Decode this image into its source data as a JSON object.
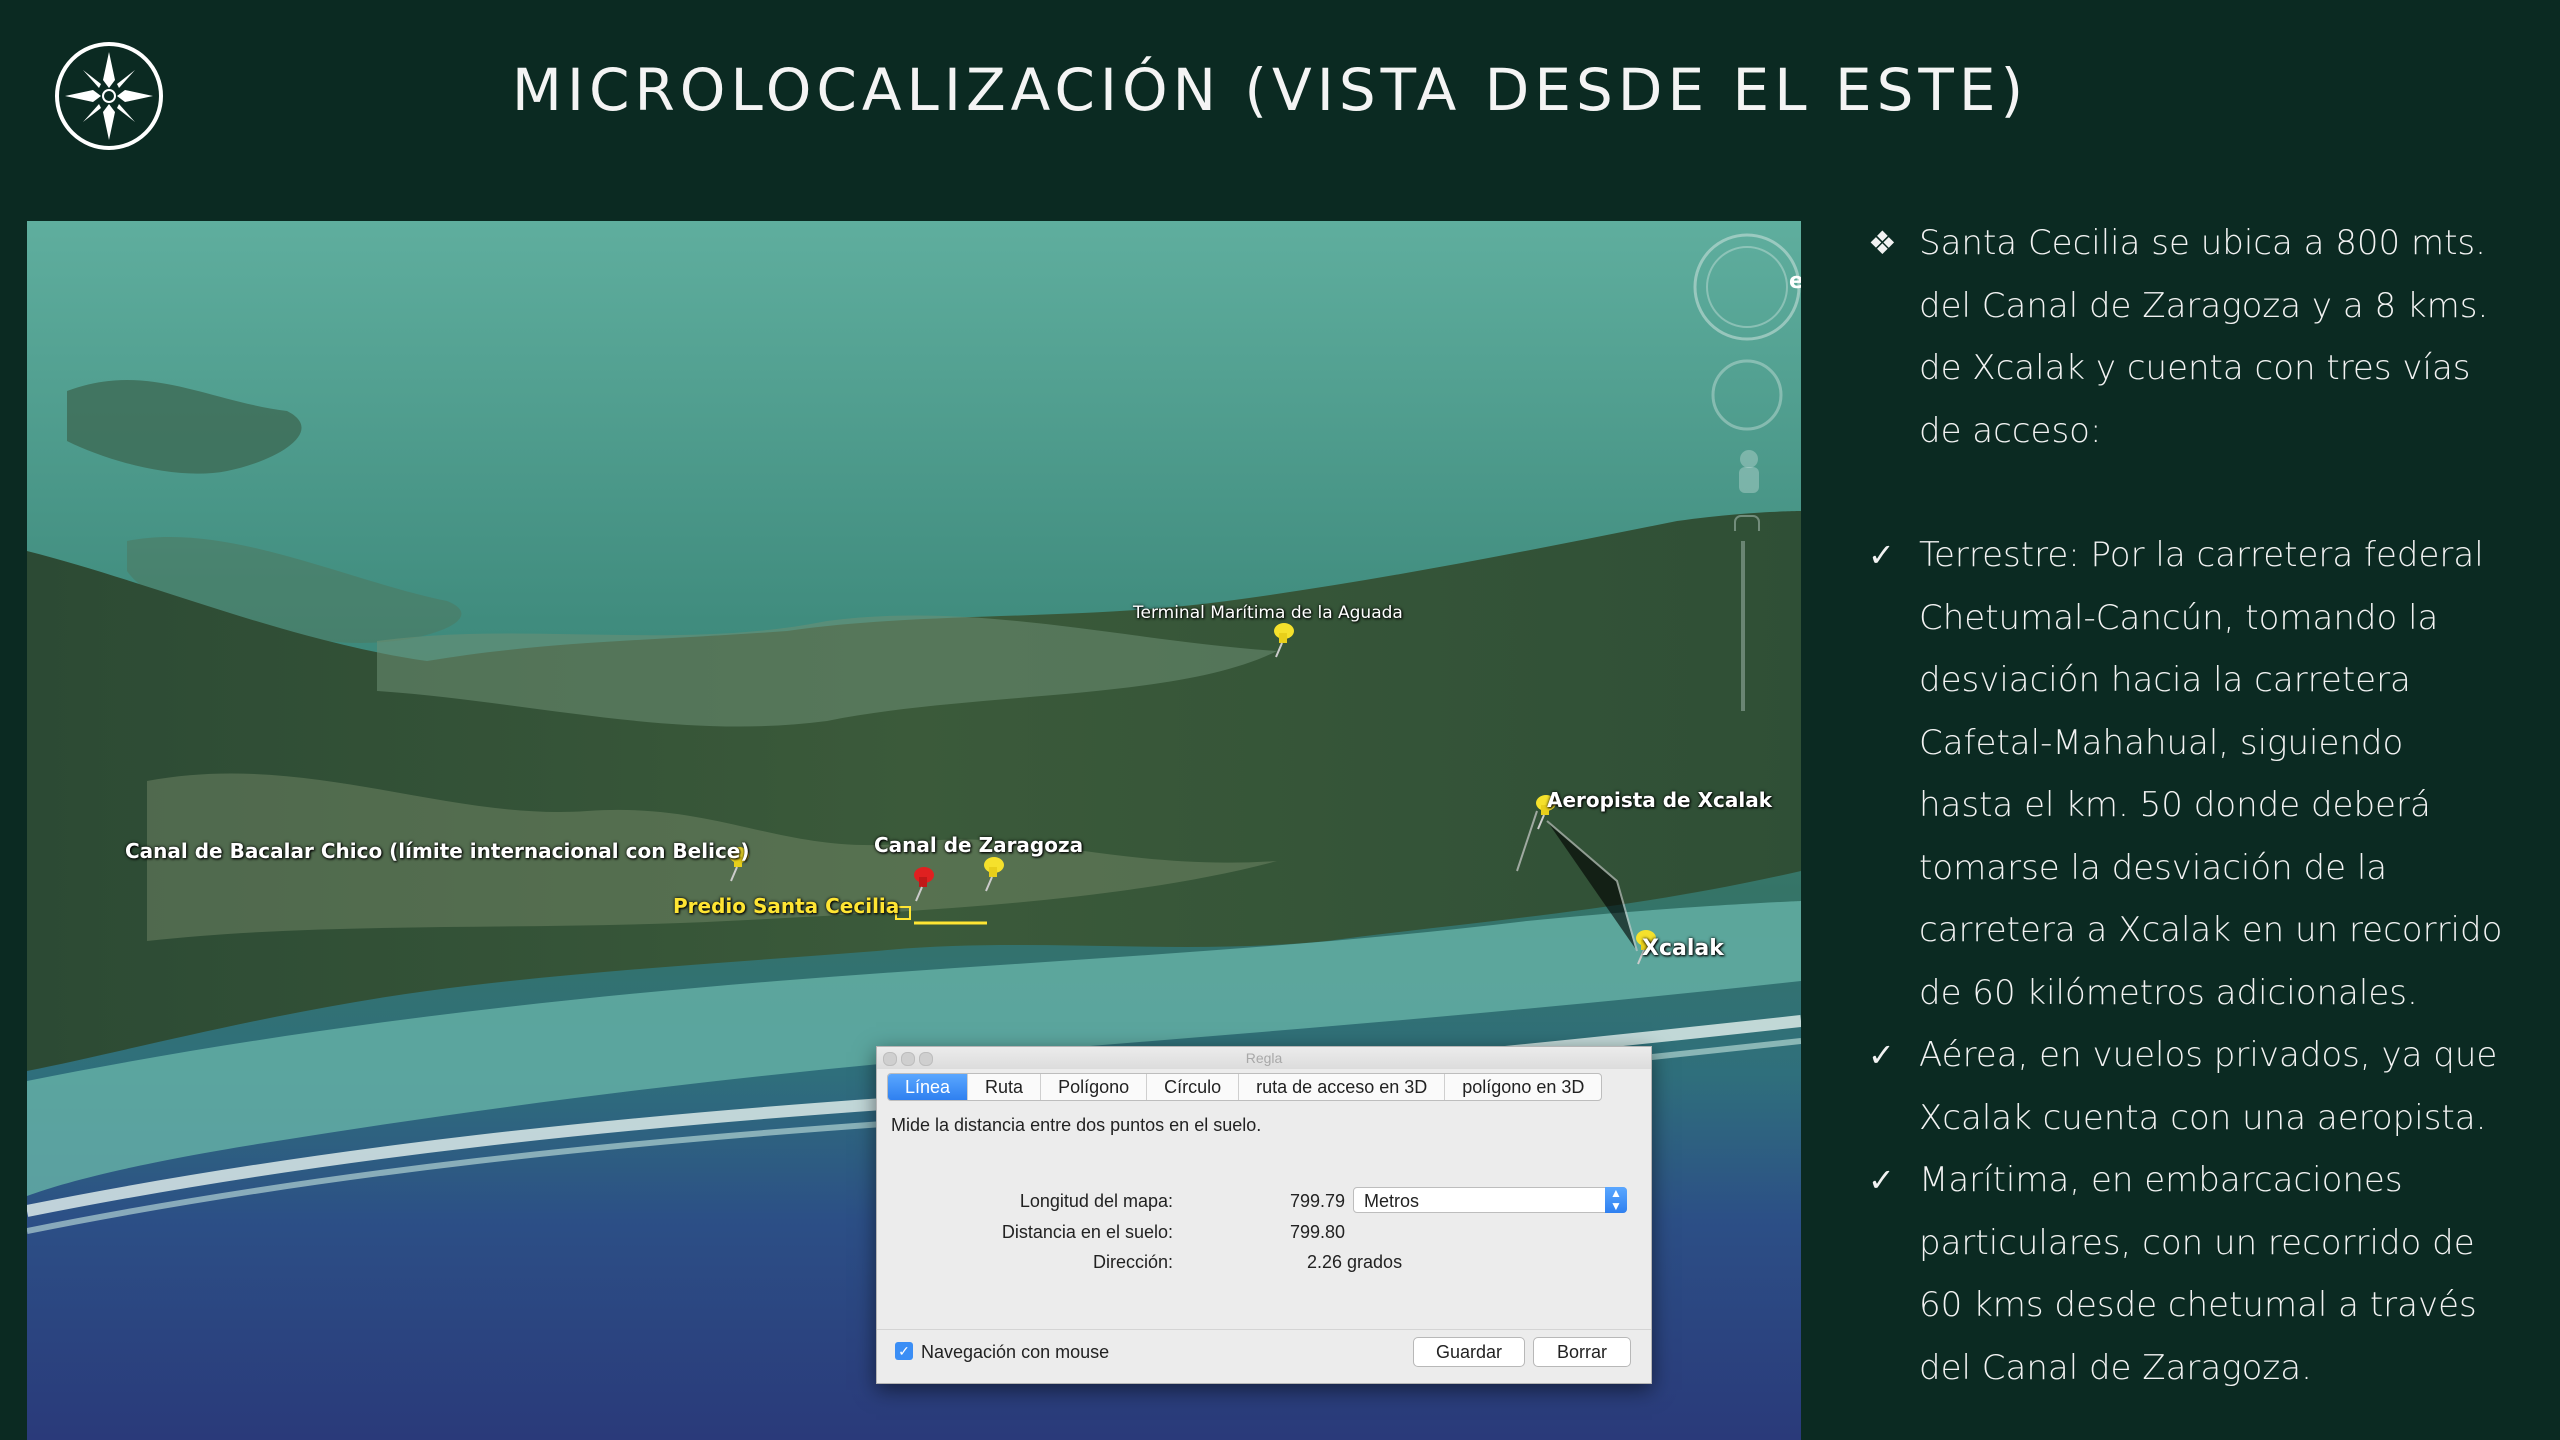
{
  "slide": {
    "title": "MICROLOCALIZACIÓN (VISTA DESDE EL ESTE)",
    "logo_icon": "compass-rose-icon"
  },
  "map": {
    "labels": {
      "terminal": "Terminal Marítima de la Aguada",
      "aeropista": "Aeropista de Xcalak",
      "bacalar": "Canal de Bacalar Chico (límite internacional con Belice)",
      "zaragoza": "Canal de Zaragoza",
      "predio": "Predio Santa Cecilia",
      "xcalak": "Xcalak"
    },
    "compass_letter": "e",
    "colors": {
      "pin_yellow": "#f5e12c",
      "pin_red": "#e02020",
      "label_yellow": "#ffe533"
    }
  },
  "ruler": {
    "window_title": "Regla",
    "tabs": [
      "Línea",
      "Ruta",
      "Polígono",
      "Círculo",
      "ruta de acceso en 3D",
      "polígono en 3D"
    ],
    "active_tab": "Línea",
    "description": "Mide la distancia entre dos puntos en el suelo.",
    "map_length_label": "Longitud del mapa:",
    "map_length_value": "799.79",
    "units": "Metros",
    "ground_distance_label": "Distancia en el suelo:",
    "ground_distance_value": "799.80",
    "heading_label": "Dirección:",
    "heading_value": "2.26 grados",
    "mouse_nav_label": "Navegación con mouse",
    "mouse_nav_checked": true,
    "save_button": "Guardar",
    "clear_button": "Borrar"
  },
  "bullets": [
    {
      "icon": "diamond-bullet-icon",
      "mark": "❖",
      "lines": [
        "Santa Cecilia se ubica a 800 mts.",
        "del Canal de Zaragoza y a 8 kms.",
        "de Xcalak y cuenta con tres vías",
        "de acceso:"
      ]
    },
    {
      "icon": "checkmark-icon",
      "mark": "✓",
      "lines": [
        "Terrestre: Por la carretera federal",
        "Chetumal-Cancún, tomando la",
        "desviación hacia la carretera",
        "Cafetal-Mahahual, siguiendo",
        "hasta el km. 50 donde deberá",
        "tomarse la desviación de la",
        "carretera  a Xcalak en un recorrido",
        "de 60 kilómetros adicionales."
      ]
    },
    {
      "icon": "checkmark-icon",
      "mark": "✓",
      "lines": [
        "Aérea, en vuelos privados, ya que",
        "Xcalak cuenta con una aeropista."
      ]
    },
    {
      "icon": "checkmark-icon",
      "mark": "✓",
      "lines": [
        "Marítima, en embarcaciones",
        "particulares, con un recorrido de",
        "60 kms desde chetumal a través",
        "del Canal de Zaragoza."
      ]
    }
  ]
}
